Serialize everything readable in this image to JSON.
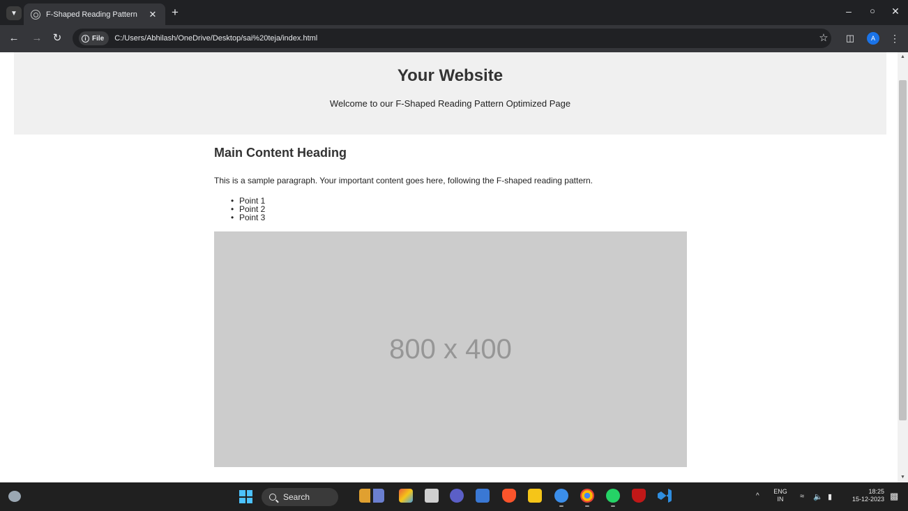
{
  "browser": {
    "tab_title": "F-Shaped Reading Pattern",
    "site_chip": "File",
    "url": "C:/Users/Abhilash/OneDrive/Desktop/sai%20teja/index.html",
    "profile_initial": "A"
  },
  "page": {
    "header": {
      "title": "Your Website",
      "subtitle": "Welcome to our F-Shaped Reading Pattern Optimized Page"
    },
    "main": {
      "heading": "Main Content Heading",
      "paragraph": "This is a sample paragraph. Your important content goes here, following the F-shaped reading pattern.",
      "points": [
        "Point 1",
        "Point 2",
        "Point 3"
      ],
      "image_placeholder": "800 x 400"
    }
  },
  "taskbar": {
    "search_label": "Search",
    "lang_primary": "ENG",
    "lang_secondary": "IN",
    "time": "18:25",
    "date": "15-12-2023"
  },
  "colors": {
    "accent": "#1a73e8",
    "header_bg": "#f0f0f0",
    "placeholder_bg": "#cccccc"
  }
}
